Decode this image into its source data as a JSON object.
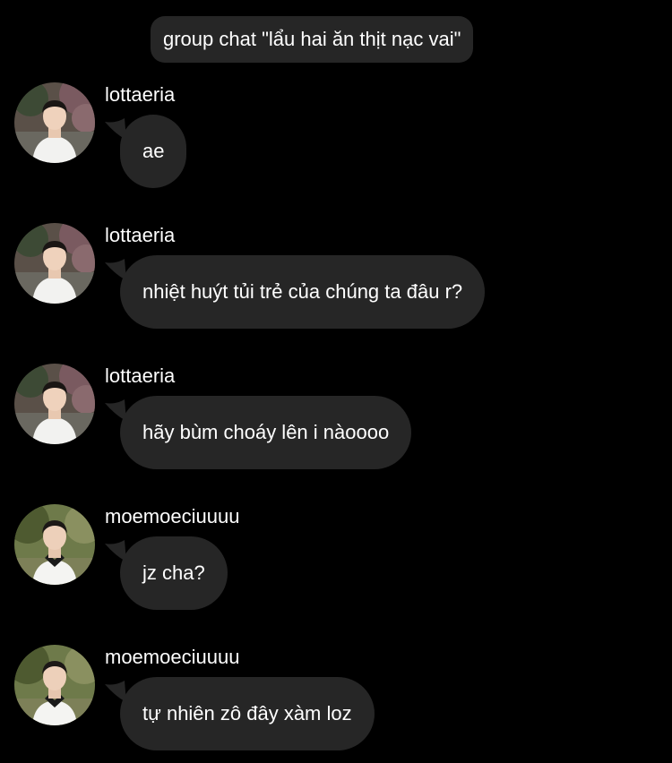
{
  "chat": {
    "title": "group chat \"lẩu hai ăn thịt nạc vai\""
  },
  "messages": [
    {
      "sender": "lottaeria",
      "text": "ae",
      "avatar": "avatar-lottaeria"
    },
    {
      "sender": "lottaeria",
      "text": "nhiệt huýt tủi trẻ của chúng ta đâu r?",
      "avatar": "avatar-lottaeria"
    },
    {
      "sender": "lottaeria",
      "text": "hãy bùm choáy lên i nàoooo",
      "avatar": "avatar-lottaeria"
    },
    {
      "sender": "moemoeciuuuu",
      "text": "jz cha?",
      "avatar": "avatar-moemoeciuuuu"
    },
    {
      "sender": "moemoeciuuuu",
      "text": "tự nhiên zô đây xàm loz",
      "avatar": "avatar-moemoeciuuuu"
    }
  ],
  "colors": {
    "background": "#000000",
    "bubble": "#262626",
    "text": "#ffffff"
  }
}
